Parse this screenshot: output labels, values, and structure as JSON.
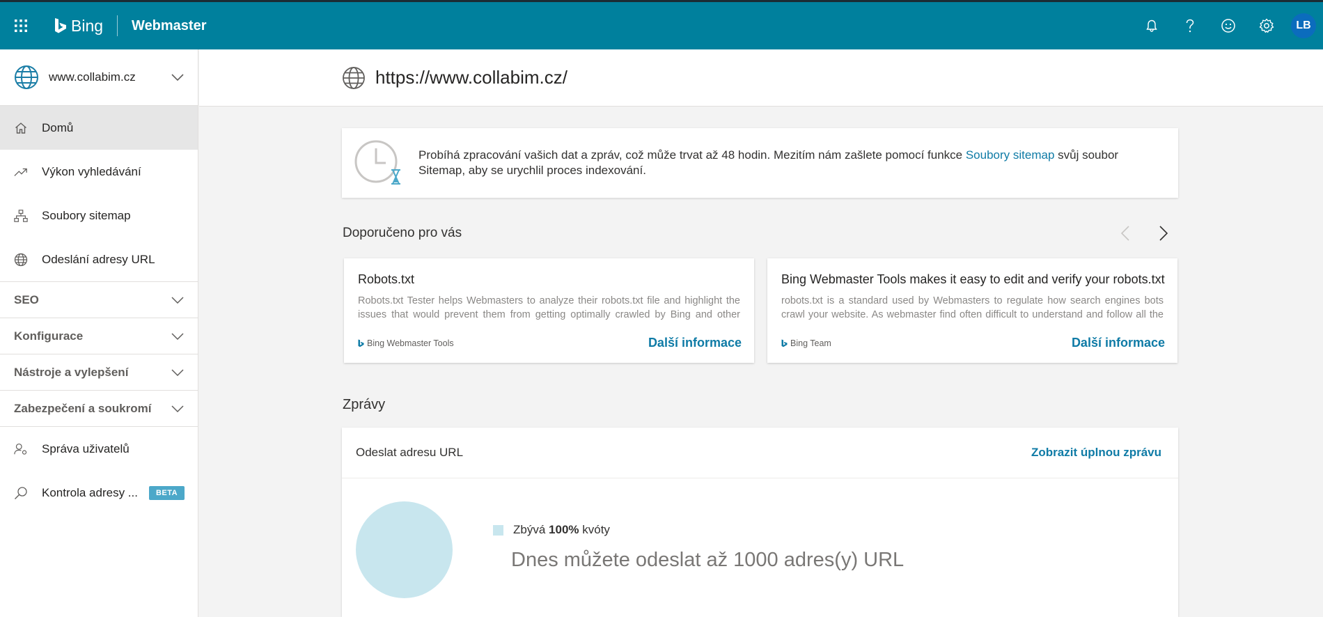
{
  "topbar": {
    "brand": "Bing",
    "product": "Webmaster",
    "avatar_initials": "LB",
    "icons": [
      "waffle-icon",
      "bell-icon",
      "help-icon",
      "smiley-icon",
      "gear-icon"
    ],
    "background_color": "#00809d"
  },
  "sidebar": {
    "site": "www.collabim.cz",
    "items": [
      {
        "label": "Domů",
        "icon": "home-icon",
        "active": true
      },
      {
        "label": "Výkon vyhledávání",
        "icon": "trend-icon"
      },
      {
        "label": "Soubory sitemap",
        "icon": "sitemap-icon"
      },
      {
        "label": "Odeslání adresy URL",
        "icon": "globe-icon"
      }
    ],
    "groups": [
      {
        "label": "SEO"
      },
      {
        "label": "Konfigurace"
      },
      {
        "label": "Nástroje a vylepšení"
      },
      {
        "label": "Zabezpečení a soukromí"
      }
    ],
    "bottom_items": [
      {
        "label": "Správa uživatelů",
        "icon": "user-settings-icon"
      },
      {
        "label": "Kontrola adresy ...",
        "icon": "search-icon",
        "badge": "BETA"
      }
    ]
  },
  "header": {
    "url": "https://www.collabim.cz/"
  },
  "info": {
    "text_before": "Probíhá zpracování vašich dat a zpráv, což může trvat až 48 hodin. Mezitím nám zašlete pomocí funkce ",
    "link": "Soubory sitemap",
    "text_after": " svůj soubor Sitemap, aby se urychlil proces indexování."
  },
  "recommended": {
    "title": "Doporučeno pro vás",
    "cards": [
      {
        "title": "Robots.txt",
        "desc": "Robots.txt Tester helps Webmasters to analyze their robots.txt file and highlight the issues that would prevent them from getting optimally crawled by Bing and other robots.",
        "source": "Bing Webmaster Tools",
        "more": "Další informace"
      },
      {
        "title": "Bing Webmaster Tools makes it easy to edit and verify your robots.txt",
        "desc": "robots.txt is a standard used by Webmasters to regulate how search engines bots crawl your website. As webmaster find often difficult to understand and follow all the necessary formats.",
        "source": "Bing Team",
        "more": "Další informace"
      }
    ]
  },
  "reports": {
    "title": "Zprávy",
    "card": {
      "title": "Odeslat adresu URL",
      "link": "Zobrazit úplnou zprávu",
      "legend_prefix": "Zbývá ",
      "legend_value": "100%",
      "legend_suffix": " kvóty",
      "quota_remaining_percent": 100,
      "message": "Dnes můžete odeslat až 1000 adres(y) URL",
      "chart_color": "#c8e6ee"
    }
  }
}
